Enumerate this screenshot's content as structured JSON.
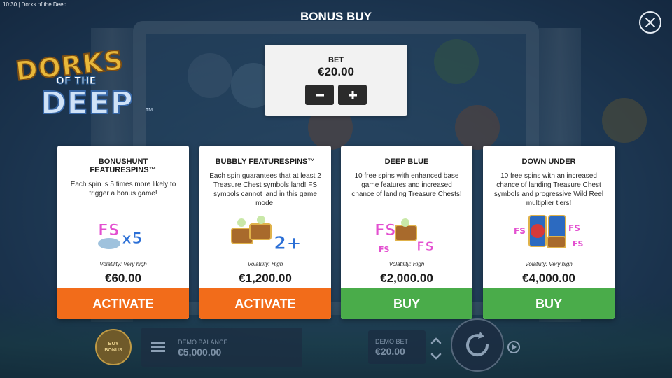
{
  "system_bar": {
    "time": "10:30",
    "app_name": "Dorks of the Deep"
  },
  "logo": {
    "line1": "DORKS",
    "line2": "OF THE",
    "line3": "DEEP",
    "tm": "TM"
  },
  "header": {
    "title": "BONUS BUY",
    "close_icon": "close-icon"
  },
  "bet": {
    "label": "BET",
    "value": "€20.00",
    "decrease_icon": "minus-icon",
    "increase_icon": "plus-icon"
  },
  "cards": [
    {
      "title": "BONUSHUNT FEATURESPINS™",
      "description": "Each spin is 5 times more likely to trigger a bonus game!",
      "volatility": "Volatility: Very high",
      "price": "€60.00",
      "action": "ACTIVATE",
      "action_color": "#f26c1a",
      "art": "fs-x5-shell-icon"
    },
    {
      "title": "BUBBLY FEATURESPINS™",
      "description": "Each spin guarantees that at least 2 Treasure Chest symbols land! FS symbols cannot land in this game mode.",
      "volatility": "Volatility: High",
      "price": "€1,200.00",
      "action": "ACTIVATE",
      "action_color": "#f26c1a",
      "art": "treasure-chests-2plus-icon"
    },
    {
      "title": "DEEP BLUE",
      "description": "10 free spins with enhanced base game features and increased chance of landing Treasure Chests!",
      "volatility": "Volatility: High",
      "price": "€2,000.00",
      "action": "BUY",
      "action_color": "#4aac4a",
      "art": "fs-treasure-chest-icon"
    },
    {
      "title": "DOWN UNDER",
      "description": "10 free spins with an increased chance of landing Treasure Chest symbols and progressive Wild Reel multiplier tiers!",
      "volatility": "Volatility: Very high",
      "price": "€4,000.00",
      "action": "BUY",
      "action_color": "#4aac4a",
      "art": "octopus-wild-reel-icon"
    }
  ],
  "bottom_bar": {
    "buy_bonus": "BUY BONUS",
    "balance_label": "DEMO BALANCE",
    "balance_value": "€5,000.00",
    "bet_label": "DEMO BET",
    "bet_value": "€20.00"
  }
}
